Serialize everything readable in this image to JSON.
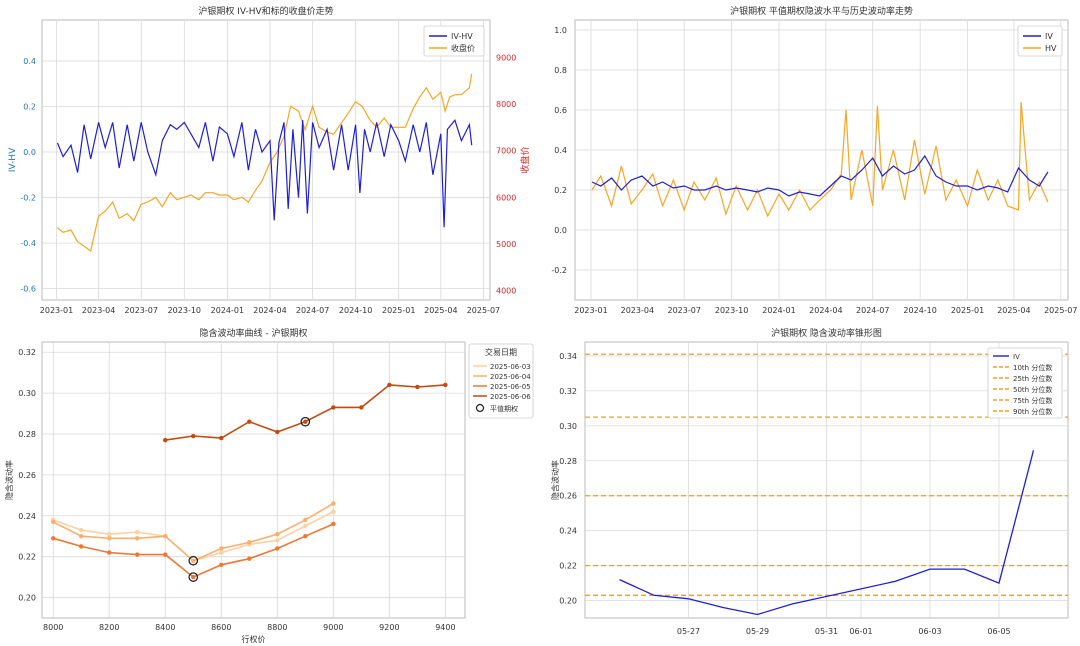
{
  "colors": {
    "iv": "#1f1fd6",
    "orange": "#f5a623",
    "red_axis": "#d62728",
    "blue_axis": "#1f77b4",
    "grid": "#d9d9d9",
    "q_line": "#f0a020"
  },
  "chart_data": [
    {
      "id": "c1",
      "type": "line",
      "title": "沪银期权 IV-HV和标的收盘价走势",
      "ylabel_left": "IV-HV",
      "ylabel_right": "收盘价",
      "xlim": [
        "2022-12-01",
        "2025-07-15"
      ],
      "ylim_left": [
        -0.65,
        0.58
      ],
      "ylim_right": [
        3800,
        9800
      ],
      "xticks": [
        "2023-01",
        "2023-04",
        "2023-07",
        "2023-10",
        "2024-01",
        "2024-04",
        "2024-07",
        "2024-10",
        "2025-01",
        "2025-04",
        "2025-07"
      ],
      "yticks_left": [
        "-0.6",
        "-0.4",
        "-0.2",
        "0.0",
        "0.2",
        "0.4"
      ],
      "yticks_right": [
        "4000",
        "5000",
        "6000",
        "7000",
        "8000",
        "9000"
      ],
      "legend": [
        "IV-HV",
        "收盘价"
      ],
      "series": [
        {
          "name": "IV-HV",
          "axis": "left",
          "color_key": "iv",
          "x": [
            "2023-01-03",
            "2023-01-15",
            "2023-02-01",
            "2023-02-15",
            "2023-03-01",
            "2023-03-15",
            "2023-04-01",
            "2023-04-15",
            "2023-05-01",
            "2023-05-15",
            "2023-06-01",
            "2023-06-15",
            "2023-07-01",
            "2023-07-15",
            "2023-08-01",
            "2023-08-15",
            "2023-09-01",
            "2023-09-15",
            "2023-10-01",
            "2023-10-15",
            "2023-11-01",
            "2023-11-15",
            "2023-12-01",
            "2023-12-15",
            "2024-01-01",
            "2024-01-15",
            "2024-02-01",
            "2024-02-15",
            "2024-03-01",
            "2024-03-15",
            "2024-04-01",
            "2024-04-10",
            "2024-04-20",
            "2024-05-01",
            "2024-05-10",
            "2024-05-20",
            "2024-06-01",
            "2024-06-10",
            "2024-06-20",
            "2024-07-01",
            "2024-07-15",
            "2024-08-01",
            "2024-08-15",
            "2024-09-01",
            "2024-09-15",
            "2024-10-01",
            "2024-10-10",
            "2024-10-20",
            "2024-11-01",
            "2024-11-15",
            "2024-12-01",
            "2024-12-15",
            "2025-01-01",
            "2025-01-15",
            "2025-02-01",
            "2025-02-15",
            "2025-03-01",
            "2025-03-15",
            "2025-04-01",
            "2025-04-08",
            "2025-04-15",
            "2025-05-01",
            "2025-05-15",
            "2025-06-01",
            "2025-06-06"
          ],
          "y": [
            0.04,
            -0.02,
            0.03,
            -0.09,
            0.12,
            -0.03,
            0.13,
            0.02,
            0.13,
            -0.07,
            0.12,
            -0.04,
            0.13,
            0.0,
            -0.1,
            0.05,
            0.12,
            0.1,
            0.13,
            0.08,
            0.02,
            0.13,
            -0.04,
            0.11,
            0.08,
            -0.02,
            0.13,
            -0.08,
            0.1,
            0.0,
            0.05,
            -0.3,
            0.04,
            0.13,
            -0.25,
            0.1,
            -0.2,
            0.14,
            -0.27,
            0.13,
            0.02,
            0.1,
            -0.08,
            0.12,
            -0.08,
            0.12,
            -0.18,
            0.1,
            0.0,
            0.13,
            -0.02,
            0.12,
            0.05,
            -0.04,
            0.12,
            0.0,
            0.13,
            -0.1,
            0.08,
            -0.33,
            0.1,
            0.14,
            0.05,
            0.12,
            0.03
          ]
        },
        {
          "name": "收盘价",
          "axis": "right",
          "color_key": "orange",
          "x": [
            "2023-01-03",
            "2023-01-15",
            "2023-02-01",
            "2023-02-15",
            "2023-03-01",
            "2023-03-15",
            "2023-04-01",
            "2023-04-15",
            "2023-05-01",
            "2023-05-15",
            "2023-06-01",
            "2023-06-15",
            "2023-07-01",
            "2023-07-15",
            "2023-08-01",
            "2023-08-15",
            "2023-09-01",
            "2023-09-15",
            "2023-10-01",
            "2023-10-15",
            "2023-11-01",
            "2023-11-15",
            "2023-12-01",
            "2023-12-15",
            "2024-01-01",
            "2024-01-15",
            "2024-02-01",
            "2024-02-15",
            "2024-03-01",
            "2024-03-15",
            "2024-04-01",
            "2024-04-15",
            "2024-05-01",
            "2024-05-15",
            "2024-06-01",
            "2024-06-15",
            "2024-07-01",
            "2024-07-15",
            "2024-08-01",
            "2024-08-15",
            "2024-09-01",
            "2024-09-15",
            "2024-10-01",
            "2024-10-15",
            "2024-11-01",
            "2024-11-15",
            "2024-12-01",
            "2024-12-15",
            "2025-01-01",
            "2025-01-15",
            "2025-02-01",
            "2025-02-15",
            "2025-03-01",
            "2025-03-15",
            "2025-04-01",
            "2025-04-10",
            "2025-04-20",
            "2025-05-01",
            "2025-05-15",
            "2025-06-01",
            "2025-06-06"
          ],
          "y": [
            5350,
            5250,
            5300,
            5050,
            4950,
            4850,
            5600,
            5700,
            5900,
            5550,
            5650,
            5500,
            5850,
            5900,
            6000,
            5800,
            6100,
            5950,
            6000,
            6050,
            5950,
            6100,
            6100,
            6050,
            6050,
            5950,
            6000,
            5900,
            6150,
            6350,
            6750,
            6950,
            7300,
            7950,
            7850,
            7450,
            7950,
            7500,
            7400,
            7350,
            7600,
            7800,
            8050,
            7950,
            7650,
            7500,
            7700,
            7500,
            7500,
            7500,
            7900,
            8150,
            8350,
            8100,
            8250,
            7850,
            8150,
            8200,
            8200,
            8350,
            8650
          ]
        }
      ]
    },
    {
      "id": "c2",
      "type": "line",
      "title": "沪银期权 平值期权隐波水平与历史波动率走势",
      "xlim": [
        "2022-12-01",
        "2025-07-15"
      ],
      "ylim": [
        -0.35,
        1.05
      ],
      "xticks": [
        "2023-01",
        "2023-04",
        "2023-07",
        "2023-10",
        "2024-01",
        "2024-04",
        "2024-07",
        "2024-10",
        "2025-01",
        "2025-04",
        "2025-07"
      ],
      "yticks": [
        "-0.2",
        "0.0",
        "0.2",
        "0.4",
        "0.6",
        "0.8",
        "1.0"
      ],
      "legend": [
        "IV",
        "HV"
      ],
      "series": [
        {
          "name": "IV",
          "color_key": "iv",
          "x": [
            "2023-01-03",
            "2023-01-20",
            "2023-02-10",
            "2023-03-01",
            "2023-03-20",
            "2023-04-10",
            "2023-05-01",
            "2023-05-20",
            "2023-06-10",
            "2023-07-01",
            "2023-07-20",
            "2023-08-10",
            "2023-09-01",
            "2023-09-20",
            "2023-10-10",
            "2023-11-01",
            "2023-11-20",
            "2023-12-10",
            "2024-01-01",
            "2024-01-20",
            "2024-02-10",
            "2024-03-01",
            "2024-03-20",
            "2024-04-10",
            "2024-05-01",
            "2024-05-20",
            "2024-06-10",
            "2024-07-01",
            "2024-07-20",
            "2024-08-10",
            "2024-09-01",
            "2024-09-20",
            "2024-10-10",
            "2024-11-01",
            "2024-11-20",
            "2024-12-10",
            "2025-01-01",
            "2025-01-20",
            "2025-02-10",
            "2025-03-01",
            "2025-03-20",
            "2025-04-10",
            "2025-05-01",
            "2025-05-20",
            "2025-06-06"
          ],
          "y": [
            0.24,
            0.22,
            0.26,
            0.2,
            0.25,
            0.27,
            0.22,
            0.24,
            0.21,
            0.22,
            0.2,
            0.2,
            0.22,
            0.2,
            0.21,
            0.2,
            0.19,
            0.21,
            0.2,
            0.17,
            0.19,
            0.18,
            0.17,
            0.22,
            0.27,
            0.25,
            0.3,
            0.36,
            0.27,
            0.32,
            0.28,
            0.3,
            0.37,
            0.27,
            0.24,
            0.22,
            0.22,
            0.2,
            0.22,
            0.21,
            0.19,
            0.31,
            0.25,
            0.22,
            0.29
          ]
        },
        {
          "name": "HV",
          "color_key": "orange",
          "x": [
            "2023-01-03",
            "2023-01-20",
            "2023-02-10",
            "2023-03-01",
            "2023-03-20",
            "2023-04-10",
            "2023-05-01",
            "2023-05-20",
            "2023-06-10",
            "2023-07-01",
            "2023-07-20",
            "2023-08-10",
            "2023-09-01",
            "2023-09-20",
            "2023-10-10",
            "2023-11-01",
            "2023-11-20",
            "2023-12-10",
            "2024-01-01",
            "2024-01-20",
            "2024-02-10",
            "2024-03-01",
            "2024-03-20",
            "2024-04-10",
            "2024-05-01",
            "2024-05-10",
            "2024-05-20",
            "2024-06-10",
            "2024-07-01",
            "2024-07-10",
            "2024-07-20",
            "2024-08-10",
            "2024-09-01",
            "2024-09-20",
            "2024-10-10",
            "2024-11-01",
            "2024-11-20",
            "2024-12-10",
            "2025-01-01",
            "2025-01-20",
            "2025-02-10",
            "2025-03-01",
            "2025-03-20",
            "2025-04-10",
            "2025-04-15",
            "2025-05-01",
            "2025-05-20",
            "2025-06-06"
          ],
          "y": [
            0.2,
            0.27,
            0.12,
            0.32,
            0.13,
            0.2,
            0.28,
            0.12,
            0.25,
            0.1,
            0.24,
            0.15,
            0.26,
            0.08,
            0.22,
            0.1,
            0.2,
            0.07,
            0.18,
            0.1,
            0.2,
            0.1,
            0.15,
            0.2,
            0.28,
            0.6,
            0.15,
            0.4,
            0.12,
            0.62,
            0.2,
            0.4,
            0.15,
            0.45,
            0.18,
            0.42,
            0.15,
            0.25,
            0.12,
            0.3,
            0.15,
            0.25,
            0.12,
            0.1,
            0.64,
            0.15,
            0.24,
            0.14
          ]
        }
      ]
    },
    {
      "id": "c3",
      "type": "line",
      "title": "隐含波动率曲线 - 沪银期权",
      "xlabel": "行权价",
      "ylabel": "隐含波动率",
      "xlim": [
        7960,
        9470
      ],
      "ylim": [
        0.19,
        0.325
      ],
      "xticks": [
        "8000",
        "8200",
        "8400",
        "8600",
        "8800",
        "9000",
        "9200",
        "9400"
      ],
      "yticks": [
        "0.20",
        "0.22",
        "0.24",
        "0.26",
        "0.28",
        "0.30",
        "0.32"
      ],
      "legend_title": "交易日期",
      "legend": [
        "2025-06-03",
        "2025-06-04",
        "2025-06-05",
        "2025-06-06",
        "平值期权"
      ],
      "series": [
        {
          "name": "2025-06-03",
          "color": "#fdd0a2",
          "x": [
            8000,
            8100,
            8200,
            8300,
            8400,
            8500,
            8600,
            8700,
            8800,
            8900,
            9000
          ],
          "y": [
            0.238,
            0.233,
            0.231,
            0.232,
            0.23,
            0.218,
            0.222,
            0.226,
            0.228,
            0.235,
            0.242
          ]
        },
        {
          "name": "2025-06-04",
          "color": "#fdae6b",
          "x": [
            8000,
            8100,
            8200,
            8300,
            8400,
            8500,
            8600,
            8700,
            8800,
            8900,
            9000
          ],
          "y": [
            0.237,
            0.23,
            0.229,
            0.229,
            0.23,
            0.218,
            0.224,
            0.227,
            0.231,
            0.238,
            0.246
          ]
        },
        {
          "name": "2025-06-05",
          "color": "#ee7733",
          "x": [
            8000,
            8100,
            8200,
            8300,
            8400,
            8500,
            8600,
            8700,
            8800,
            8900,
            9000
          ],
          "y": [
            0.229,
            0.225,
            0.222,
            0.221,
            0.221,
            0.21,
            0.216,
            0.219,
            0.224,
            0.23,
            0.236
          ]
        },
        {
          "name": "2025-06-06",
          "color": "#c04a10",
          "x": [
            8400,
            8500,
            8600,
            8700,
            8800,
            8900,
            9000,
            9100,
            9200,
            9300,
            9400
          ],
          "y": [
            0.277,
            0.279,
            0.278,
            0.286,
            0.281,
            0.286,
            0.293,
            0.293,
            0.304,
            0.303,
            0.304
          ]
        }
      ],
      "atm_points": [
        {
          "x": 8500,
          "y": 0.218
        },
        {
          "x": 8500,
          "y": 0.21
        },
        {
          "x": 8900,
          "y": 0.286
        }
      ]
    },
    {
      "id": "c4",
      "type": "line",
      "title": "沪银期权 隐含波动率锥形图",
      "ylabel": "隐含波动率",
      "xlim": [
        "2025-05-24",
        "2025-06-07"
      ],
      "ylim": [
        0.19,
        0.348
      ],
      "xticks": [
        "05-27",
        "05-29",
        "05-31",
        "06-01",
        "06-03",
        "06-05"
      ],
      "xtick_dates": [
        "2025-05-27",
        "2025-05-29",
        "2025-05-31",
        "2025-06-01",
        "2025-06-03",
        "2025-06-05"
      ],
      "yticks": [
        "0.20",
        "0.22",
        "0.24",
        "0.26",
        "0.28",
        "0.30",
        "0.32",
        "0.34"
      ],
      "legend": [
        "IV",
        "10th 分位数",
        "25th 分位数",
        "50th 分位数",
        "75th 分位数",
        "90th 分位数"
      ],
      "iv": {
        "x": [
          "2025-05-25",
          "2025-05-26",
          "2025-05-27",
          "2025-05-28",
          "2025-05-29",
          "2025-05-30",
          "2025-06-02",
          "2025-06-03",
          "2025-06-04",
          "2025-06-05",
          "2025-06-06"
        ],
        "y": [
          0.212,
          0.203,
          0.201,
          0.196,
          0.192,
          0.198,
          0.211,
          0.218,
          0.218,
          0.21,
          0.286
        ]
      },
      "quantiles": [
        0.203,
        0.22,
        0.26,
        0.305,
        0.341
      ]
    }
  ]
}
